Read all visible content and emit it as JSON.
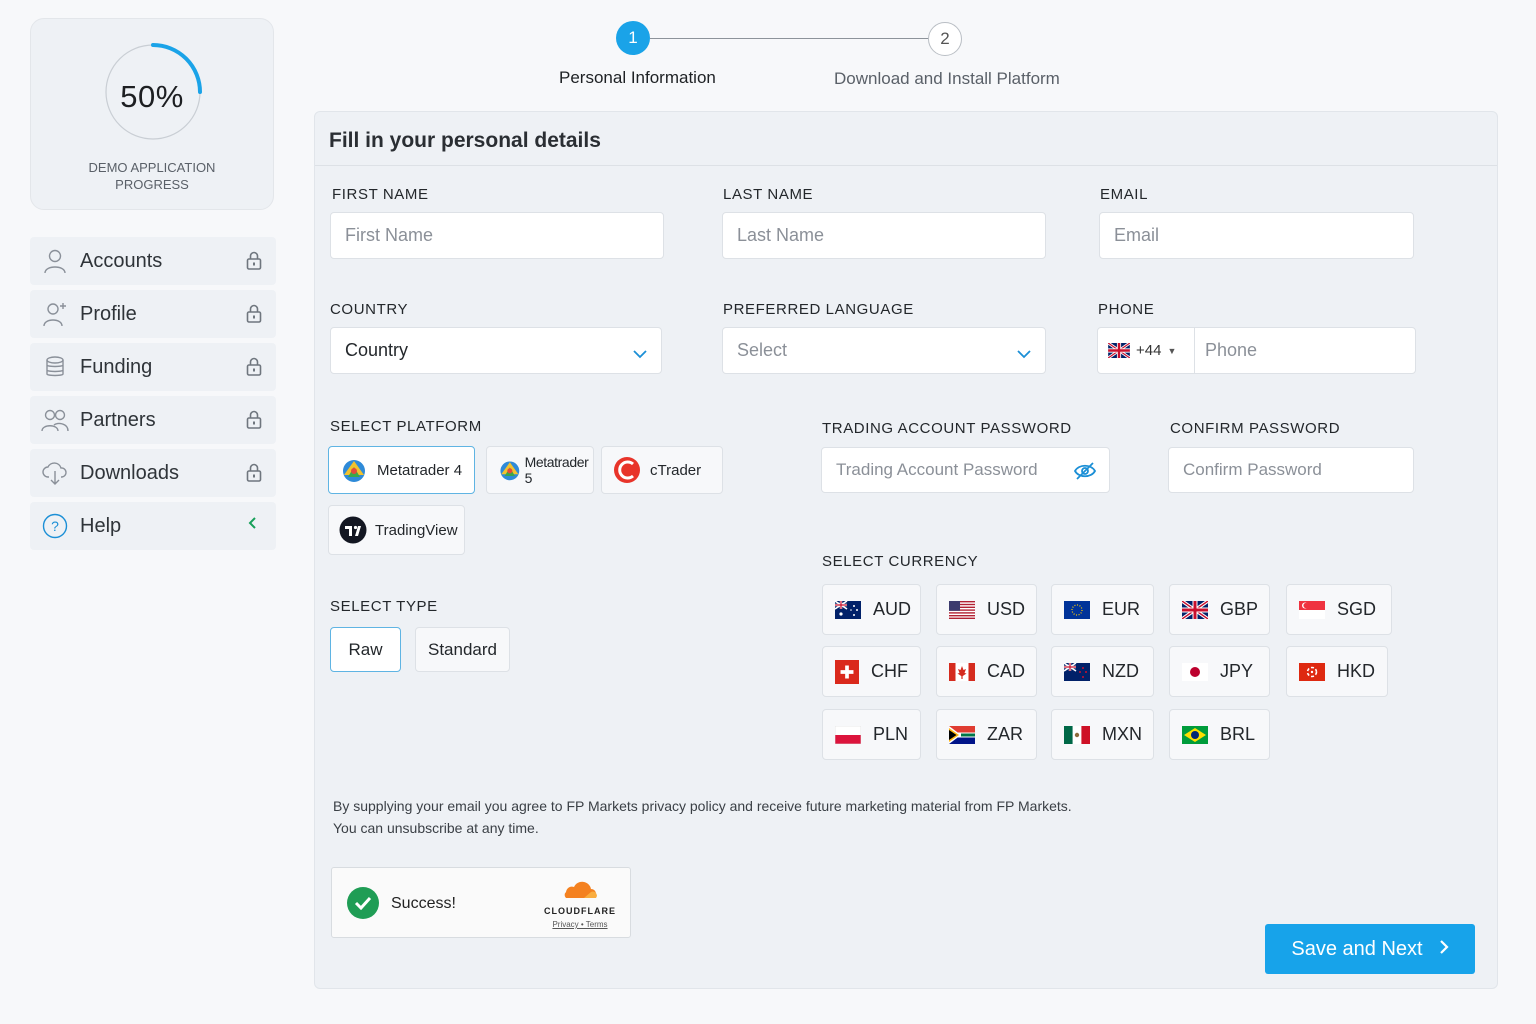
{
  "progress": {
    "percent_label": "50%",
    "percent": 0.5,
    "label": "DEMO APPLICATION PROGRESS"
  },
  "sidebar": {
    "items": [
      {
        "label": "Accounts",
        "icon": "user-icon",
        "status": "lock-icon"
      },
      {
        "label": "Profile",
        "icon": "user-add-icon",
        "status": "lock-icon"
      },
      {
        "label": "Funding",
        "icon": "coins-icon",
        "status": "lock-icon"
      },
      {
        "label": "Partners",
        "icon": "users-icon",
        "status": "lock-icon"
      },
      {
        "label": "Downloads",
        "icon": "cloud-download-icon",
        "status": "lock-icon"
      },
      {
        "label": "Help",
        "icon": "help-icon",
        "status": "chevron-left-icon"
      }
    ]
  },
  "stepper": {
    "steps": [
      {
        "number": "1",
        "label": "Personal Information",
        "active": true
      },
      {
        "number": "2",
        "label": "Download and Install Platform",
        "active": false
      }
    ]
  },
  "form": {
    "title": "Fill in your personal details",
    "first_name": {
      "label": "FIRST NAME",
      "placeholder": "First Name",
      "value": ""
    },
    "last_name": {
      "label": "LAST NAME",
      "placeholder": "Last Name",
      "value": ""
    },
    "email": {
      "label": "EMAIL",
      "placeholder": "Email",
      "value": ""
    },
    "country": {
      "label": "COUNTRY",
      "value": "Country"
    },
    "language": {
      "label": "PREFERRED LANGUAGE",
      "value": "Select"
    },
    "phone": {
      "label": "PHONE",
      "country_code": "+44",
      "placeholder": "Phone",
      "value": ""
    },
    "platform": {
      "label": "SELECT PLATFORM",
      "options": [
        "Metatrader 4",
        "Metatrader 5",
        "cTrader",
        "TradingView"
      ],
      "selected": "Metatrader 4"
    },
    "trading_password": {
      "label": "TRADING ACCOUNT PASSWORD",
      "placeholder": "Trading Account Password"
    },
    "confirm_password": {
      "label": "CONFIRM PASSWORD",
      "placeholder": "Confirm Password"
    },
    "type": {
      "label": "SELECT TYPE",
      "options": [
        "Raw",
        "Standard"
      ],
      "selected": "Raw"
    },
    "currency": {
      "label": "SELECT CURRENCY",
      "options": [
        "AUD",
        "USD",
        "EUR",
        "GBP",
        "SGD",
        "CHF",
        "CAD",
        "NZD",
        "JPY",
        "HKD",
        "PLN",
        "ZAR",
        "MXN",
        "BRL"
      ]
    },
    "consent_line1": "By supplying your email you agree to FP Markets privacy policy and receive future marketing material from FP Markets.",
    "consent_line2": "You can unsubscribe at any time.",
    "captcha": {
      "status": "Success!",
      "brand": "CLOUDFLARE",
      "links": "Privacy • Terms"
    },
    "submit_label": "Save and Next"
  },
  "colors": {
    "accent": "#17a3ea",
    "success": "#1f9d55",
    "panel": "#eef1f5"
  }
}
